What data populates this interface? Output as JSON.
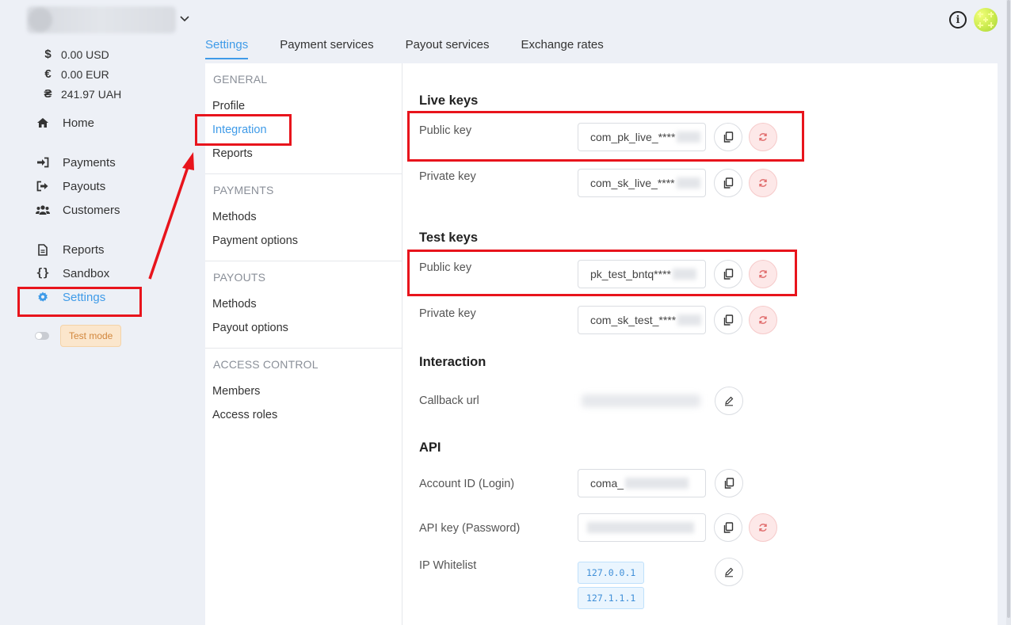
{
  "header": {
    "account_switch_icon": "chevron-down-icon",
    "info_icon": "info-icon",
    "info_glyph": "i"
  },
  "balances": [
    {
      "symbol": "$",
      "value": "0.00 USD"
    },
    {
      "symbol": "€",
      "value": "0.00 EUR"
    },
    {
      "symbol": "₴",
      "value": "241.97 UAH"
    }
  ],
  "sidebar": {
    "items": [
      {
        "label": "Home",
        "icon": "home-icon"
      },
      {
        "label": "Payments",
        "icon": "sign-in-icon"
      },
      {
        "label": "Payouts",
        "icon": "sign-out-icon"
      },
      {
        "label": "Customers",
        "icon": "users-icon"
      },
      {
        "label": "Reports",
        "icon": "document-icon"
      },
      {
        "label": "Sandbox",
        "icon": "braces-icon"
      },
      {
        "label": "Settings",
        "icon": "gear-icon",
        "active": true
      }
    ],
    "test_mode_label": "Test mode"
  },
  "tabs": [
    {
      "label": "Settings",
      "active": true
    },
    {
      "label": "Payment services"
    },
    {
      "label": "Payout services"
    },
    {
      "label": "Exchange rates"
    }
  ],
  "subnav": {
    "general_heading": "GENERAL",
    "general_items": [
      "Profile",
      "Integration",
      "Reports"
    ],
    "payments_heading": "PAYMENTS",
    "payments_items": [
      "Methods",
      "Payment options"
    ],
    "payouts_heading": "PAYOUTS",
    "payouts_items": [
      "Methods",
      "Payout options"
    ],
    "access_heading": "ACCESS CONTROL",
    "access_items": [
      "Members",
      "Access roles"
    ],
    "active_item": "Integration"
  },
  "integration": {
    "live_keys_title": "Live keys",
    "live_public_label": "Public key",
    "live_public_value": "com_pk_live_****",
    "live_private_label": "Private key",
    "live_private_value": "com_sk_live_****",
    "test_keys_title": "Test keys",
    "test_public_label": "Public key",
    "test_public_value": "pk_test_bntq****",
    "test_private_label": "Private key",
    "test_private_value": "com_sk_test_****",
    "interaction_title": "Interaction",
    "callback_label": "Callback url",
    "api_title": "API",
    "account_id_label": "Account ID (Login)",
    "account_id_value": "coma_",
    "api_key_label": "API key (Password)",
    "ip_whitelist_label": "IP Whitelist",
    "ip_whitelist": [
      "127.0.0.1",
      "127.1.1.1"
    ]
  },
  "colors": {
    "accent": "#3f9be8",
    "highlight": "#e8141c",
    "danger_bg": "#fde8e8"
  }
}
